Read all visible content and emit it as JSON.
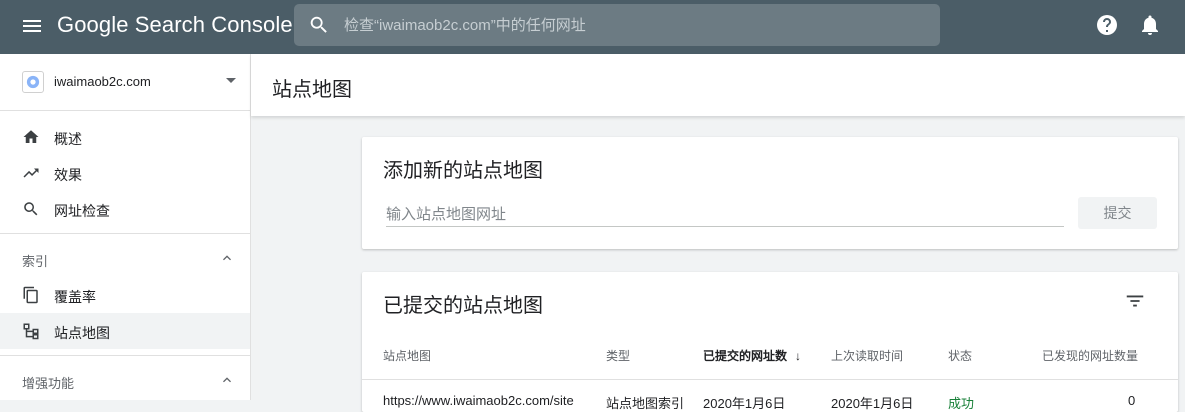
{
  "app": {
    "title": "Google Search Console",
    "search_placeholder": "检查“iwaimaob2c.com”中的任何网址"
  },
  "sidebar": {
    "property": "iwaimaob2c.com",
    "items": [
      {
        "label": "概述",
        "icon": "home-icon"
      },
      {
        "label": "效果",
        "icon": "trending-up-icon"
      },
      {
        "label": "网址检查",
        "icon": "search-icon"
      }
    ],
    "sections": [
      {
        "label": "索引",
        "items": [
          {
            "label": "覆盖率",
            "icon": "copy-icon"
          },
          {
            "label": "站点地图",
            "icon": "sitemap-icon",
            "active": true
          }
        ]
      },
      {
        "label": "增强功能"
      }
    ]
  },
  "page": {
    "title": "站点地图"
  },
  "add_card": {
    "title": "添加新的站点地图",
    "input_placeholder": "输入站点地图网址",
    "submit_label": "提交"
  },
  "list_card": {
    "title": "已提交的站点地图",
    "columns": [
      "站点地图",
      "类型",
      "已提交的网址数",
      "上次读取时间",
      "状态",
      "已发现的网址数量"
    ],
    "sorted_column": 2,
    "rows": [
      {
        "sitemap": "https://www.iwaimaob2c.com/site",
        "type": "站点地图索引",
        "submitted": "2020年1月6日",
        "last_read": "2020年1月6日",
        "status": "成功",
        "discovered": "0"
      }
    ]
  }
}
